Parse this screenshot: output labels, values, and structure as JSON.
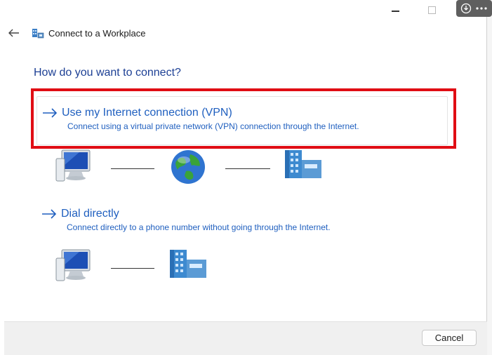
{
  "window": {
    "title": "Connect to a Workplace"
  },
  "heading": "How do you want to connect?",
  "options": [
    {
      "title": "Use my Internet connection (VPN)",
      "description": "Connect using a virtual private network (VPN) connection through the Internet.",
      "highlighted": true
    },
    {
      "title": "Dial directly",
      "description": "Connect directly to a phone number without going through the Internet.",
      "highlighted": false
    }
  ],
  "footer": {
    "cancel_label": "Cancel"
  },
  "icons": {
    "back": "back-arrow-icon",
    "app": "workplace-network-icon",
    "option_arrow": "right-arrow-icon",
    "computer": "computer-icon",
    "globe": "globe-icon",
    "building": "office-building-icon",
    "download": "download-icon",
    "more": "more-icon"
  },
  "colors": {
    "heading": "#1c3f94",
    "link": "#1f5fbf",
    "highlight_border": "#e00d14",
    "footer_bg": "#f0f0f0"
  }
}
